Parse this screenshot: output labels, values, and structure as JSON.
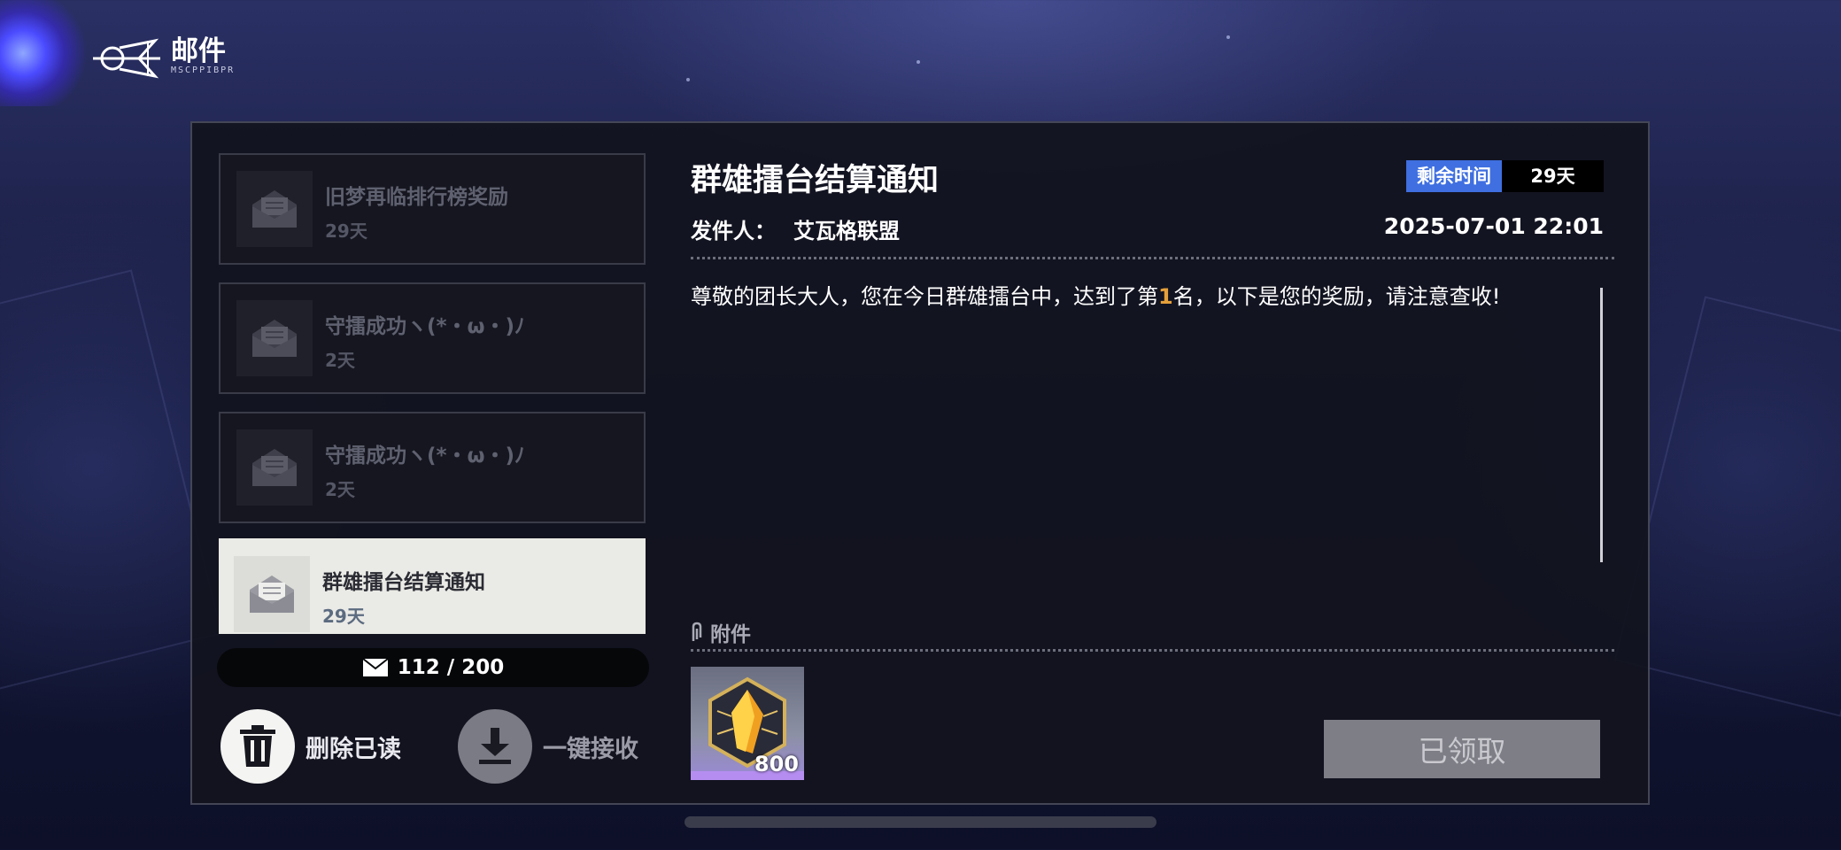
{
  "header": {
    "title": "邮件",
    "subtitle": "MSCPPIBPR"
  },
  "mail_list": [
    {
      "title": "旧梦再临排行榜奖励",
      "days": "29天",
      "active": false
    },
    {
      "title": "守擂成功ヽ(*・ω・)ﾉ",
      "days": "2天",
      "active": false
    },
    {
      "title": "守擂成功ヽ(*・ω・)ﾉ",
      "days": "2天",
      "active": false
    },
    {
      "title": "群雄擂台结算通知",
      "days": "29天",
      "active": true
    }
  ],
  "counter": {
    "icon": "envelope-icon",
    "value": "112 / 200"
  },
  "actions": {
    "delete_read": "删除已读",
    "receive_all": "一键接收"
  },
  "detail": {
    "title": "群雄擂台结算通知",
    "remaining_label": "剩余时间",
    "remaining_value": "29天",
    "sender_label": "发件人：",
    "sender_name": "艾瓦格联盟",
    "date": "2025-07-01 22:01",
    "body_before": "尊敬的团长大人，您在今日群雄擂台中，达到了第",
    "body_rank": "1",
    "body_after": "名，以下是您的奖励，请注意查收!",
    "attachment_label": "附件",
    "attachments": [
      {
        "icon": "crystal-item-icon",
        "quantity": "800"
      }
    ],
    "claim_button": "已领取"
  },
  "colors": {
    "accent_blue": "#3f6fe0",
    "rank_highlight": "#e6a03a",
    "claimed_button": "#7d7e86"
  }
}
